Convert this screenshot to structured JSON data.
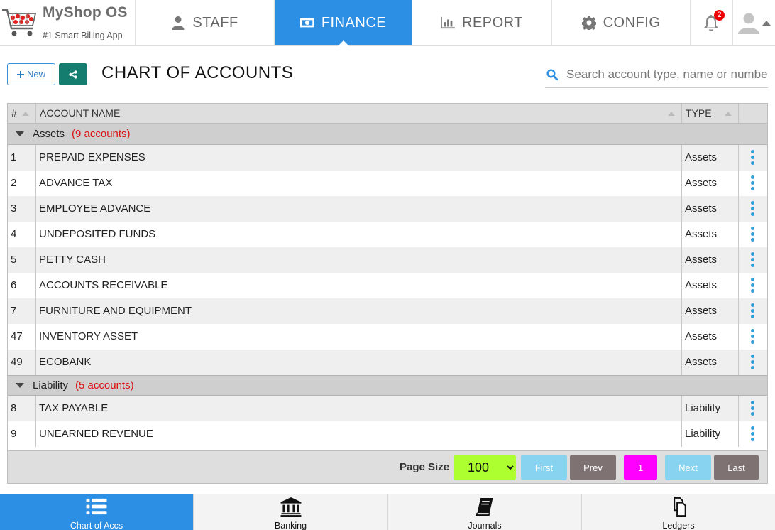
{
  "app": {
    "name": "MyShop OS",
    "tagline": "#1 Smart Billing App",
    "logo_icon": "shopping-cart-icon"
  },
  "nav": {
    "tabs": [
      {
        "label": "STAFF",
        "icon": "user-icon",
        "active": false
      },
      {
        "label": "FINANCE",
        "icon": "money-icon",
        "active": true
      },
      {
        "label": "REPORT",
        "icon": "bar-chart-icon",
        "active": false
      },
      {
        "label": "CONFIG",
        "icon": "gear-icon",
        "active": false
      }
    ],
    "notifications": {
      "icon": "bell-icon",
      "count": "2"
    },
    "user": {
      "icon": "avatar-icon"
    }
  },
  "toolbar": {
    "new_label": "New",
    "share_icon": "share-icon",
    "title": "CHART OF ACCOUNTS",
    "search_placeholder": "Search account type, name or number"
  },
  "table": {
    "columns": [
      "#",
      "ACCOUNT NAME",
      "TYPE",
      ""
    ],
    "groups": [
      {
        "name": "Assets",
        "count_label": "(9 accounts)",
        "rows": [
          {
            "num": "1",
            "name": "PREPAID EXPENSES",
            "type": "Assets"
          },
          {
            "num": "2",
            "name": "ADVANCE TAX",
            "type": "Assets"
          },
          {
            "num": "3",
            "name": "EMPLOYEE ADVANCE",
            "type": "Assets"
          },
          {
            "num": "4",
            "name": "UNDEPOSITED FUNDS",
            "type": "Assets"
          },
          {
            "num": "5",
            "name": "PETTY CASH",
            "type": "Assets"
          },
          {
            "num": "6",
            "name": "ACCOUNTS RECEIVABLE",
            "type": "Assets"
          },
          {
            "num": "7",
            "name": "FURNITURE AND EQUIPMENT",
            "type": "Assets"
          },
          {
            "num": "47",
            "name": "INVENTORY ASSET",
            "type": "Assets"
          },
          {
            "num": "49",
            "name": "ECOBANK",
            "type": "Assets"
          }
        ]
      },
      {
        "name": "Liability",
        "count_label": "(5 accounts)",
        "rows": [
          {
            "num": "8",
            "name": "TAX PAYABLE",
            "type": "Liability"
          },
          {
            "num": "9",
            "name": "UNEARNED REVENUE",
            "type": "Liability"
          }
        ]
      }
    ]
  },
  "pager": {
    "page_size_label": "Page Size",
    "page_size": "100",
    "first": "First",
    "prev": "Prev",
    "current": "1",
    "next": "Next",
    "last": "Last"
  },
  "bottom_nav": [
    {
      "label": "Chart of Accs",
      "icon": "list-icon",
      "active": true
    },
    {
      "label": "Banking",
      "icon": "bank-icon",
      "active": false
    },
    {
      "label": "Journals",
      "icon": "book-icon",
      "active": false
    },
    {
      "label": "Ledgers",
      "icon": "copy-icon",
      "active": false
    }
  ],
  "colors": {
    "accent": "#2d8fe4",
    "share_button": "#147d6f",
    "group_count": "#dd1111",
    "page_size_bg": "#adff2f",
    "current_page": "#ff00ff"
  }
}
